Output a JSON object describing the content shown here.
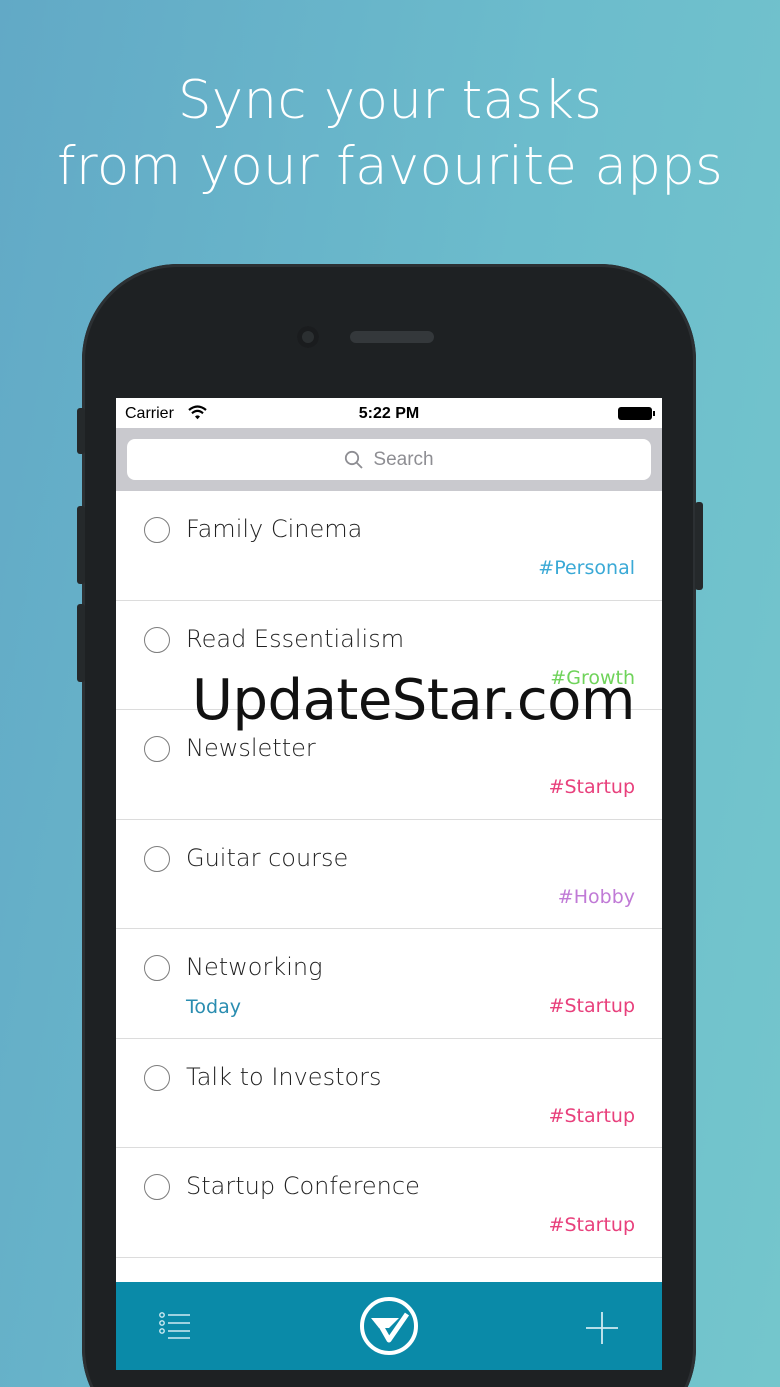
{
  "headline": {
    "line1": "Sync your tasks",
    "line2": "from your favourite apps"
  },
  "status_bar": {
    "carrier": "Carrier",
    "time": "5:22 PM"
  },
  "search": {
    "placeholder": "Search"
  },
  "tasks": [
    {
      "title": "Family Cinema",
      "date": "",
      "tag": "#Personal",
      "tag_color": "#3aa9d6"
    },
    {
      "title": "Read Essentialism",
      "date": "",
      "tag": "#Growth",
      "tag_color": "#6fd35a"
    },
    {
      "title": "Newsletter",
      "date": "",
      "tag": "#Startup",
      "tag_color": "#e8407c"
    },
    {
      "title": "Guitar course",
      "date": "",
      "tag": "#Hobby",
      "tag_color": "#c07ad6"
    },
    {
      "title": "Networking",
      "date": "Today",
      "tag": "#Startup",
      "tag_color": "#e8407c"
    },
    {
      "title": "Talk to Investors",
      "date": "",
      "tag": "#Startup",
      "tag_color": "#e8407c"
    },
    {
      "title": "Startup Conference",
      "date": "",
      "tag": "#Startup",
      "tag_color": "#e8407c"
    }
  ],
  "tab_bar": {
    "left_icon": "list-icon",
    "center_icon": "app-logo-icon",
    "right_icon": "add-icon",
    "background": "#0a8aa8"
  },
  "watermark": "UpdateStar.com"
}
